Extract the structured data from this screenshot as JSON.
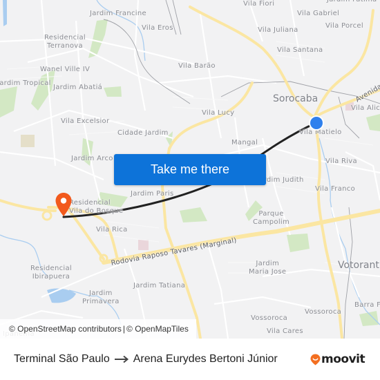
{
  "map": {
    "labels": {
      "jardim_francine": "Jardim Francine",
      "vila_fiori": "Vila Fiori",
      "vila_gabriel": "Vila Gabriel",
      "jardim_fatima": "Jardim Fátima",
      "residencial_terranova": [
        "Residencial",
        "Terranova"
      ],
      "vila_eros": "Vila Eros",
      "vila_juliana": "Vila Juliana",
      "vila_porcel": "Vila Porcel",
      "vila_santana": "Vila Santana",
      "wanel_ville": "Wanel Ville IV",
      "vila_barao": "Vila Barão",
      "jardim_tropical": "Jardim Tropical",
      "jardim_abatia": "Jardim Abatiá",
      "sorocaba": "Sorocaba",
      "avenida": "Avenida",
      "vila_alice": "Vila Alic",
      "vila_lucy": "Vila Lucy",
      "vila_excelsior": "Vila Excelsior",
      "cidade_jardim": "Cidade Jardim",
      "vila_matielo": "Vila Matielo",
      "mangal": "Mangal",
      "jardim_arco": "Jardim Arco",
      "vila_riva": "Vila Riva",
      "jardim_judith": "Jardim Judith",
      "jardim_paris": "Jardim Paris",
      "vila_franco": "Vila Franco",
      "residencial_vila_bosque": [
        "Residencial",
        "Vila do Bosque"
      ],
      "parque_campolim": [
        "Parque",
        "Campolim"
      ],
      "vila_rica": "Vila Rica",
      "rodovia": "Rodovia Raposo Tavares (Marginal)",
      "votorantim": "Votoranti",
      "residencial_ibirapuera": [
        "Residencial",
        "Ibirapuera"
      ],
      "jardim_maria_jose": [
        "Jardim",
        "Maria Jose"
      ],
      "jardim_tatiana": "Jardim Tatiana",
      "barra_funda": "Barra F",
      "jardim_primavera": [
        "Jardim",
        "Primavera"
      ],
      "vossoroca_1": "Vossoroca",
      "vossoroca_2": "Vossoroca",
      "vila_cares": "Vila Cares",
      "ipanema": "Ipanema"
    },
    "take_me_there": "Take me there",
    "attribution": {
      "osm": "© OpenStreetMap contributors",
      "separator": "|",
      "omt": "© OpenMapTiles"
    },
    "colors": {
      "route": "#222222",
      "origin_pin": "#f25a1d",
      "destination_dot": "#2f80ed",
      "button": "#0d73d9"
    }
  },
  "footer": {
    "origin": "Terminal São Paulo",
    "destination": "Arena Eurydes Bertoni Júnior",
    "brand": "moovit"
  }
}
